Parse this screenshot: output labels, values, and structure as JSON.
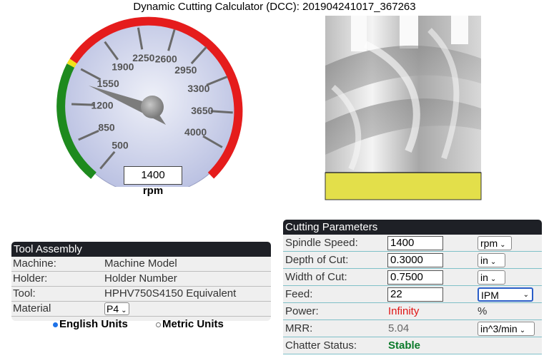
{
  "title": "Dynamic Cutting Calculator (DCC): 201904241017_367263",
  "gauge": {
    "ticks": [
      "500",
      "850",
      "1200",
      "1550",
      "1900",
      "2250",
      "2600",
      "2950",
      "3300",
      "3650",
      "4000"
    ],
    "value": "1400",
    "unit": "rpm",
    "colors": {
      "green": "#1e8a1e",
      "yellow": "#f2e21a",
      "red": "#e51c1c",
      "face": "#c7cde6"
    }
  },
  "tool_image": {
    "highlight_color": "#e3df4a"
  },
  "tool_assembly": {
    "header": "Tool Assembly",
    "rows": [
      {
        "label": "Machine:",
        "value": "Machine Model"
      },
      {
        "label": "Holder:",
        "value": "Holder Number"
      },
      {
        "label": "Tool:",
        "value": "HPHV750S4150 Equivalent"
      },
      {
        "label": "Material",
        "value": "P4"
      }
    ]
  },
  "units": {
    "english": "English Units",
    "metric": "Metric Units",
    "selected": "english"
  },
  "cutting": {
    "header": "Cutting Parameters",
    "spindle": {
      "label": "Spindle Speed:",
      "value": "1400",
      "unit": "rpm"
    },
    "depth": {
      "label": "Depth of Cut:",
      "value": "0.3000",
      "unit": "in"
    },
    "width": {
      "label": "Width of Cut:",
      "value": "0.7500",
      "unit": "in"
    },
    "feed": {
      "label": "Feed:",
      "value": "22",
      "unit": "IPM"
    },
    "power": {
      "label": "Power:",
      "value": "Infinity",
      "unit": "%"
    },
    "mrr": {
      "label": "MRR:",
      "value": "5.04",
      "unit": "in^3/min"
    },
    "chatter": {
      "label": "Chatter Status:",
      "value": "Stable"
    }
  }
}
